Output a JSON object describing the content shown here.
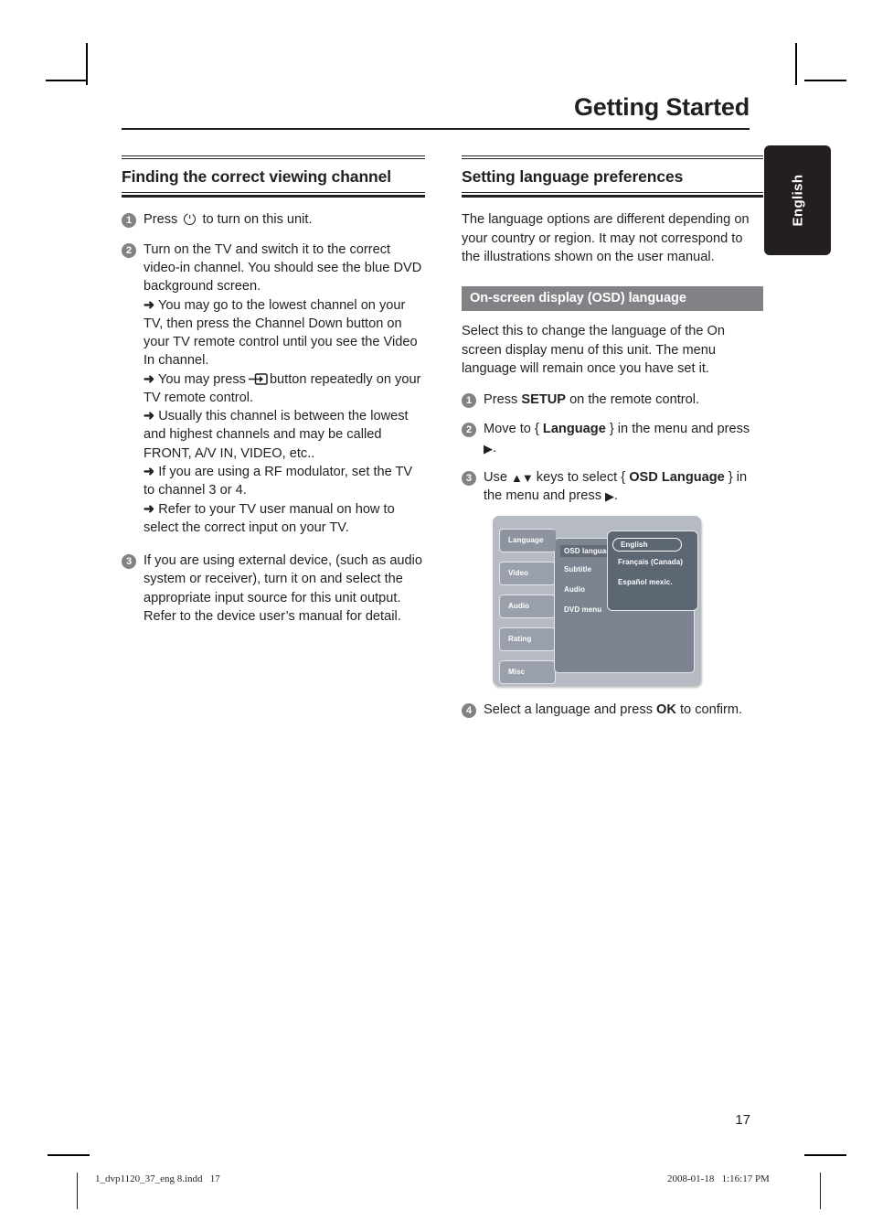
{
  "header": {
    "title": "Getting Started"
  },
  "side_tab": {
    "label": "English"
  },
  "left_column": {
    "heading": "Finding the correct viewing channel",
    "steps": [
      {
        "num": "1",
        "text_before": "Press",
        "icon": "power-icon",
        "text_after": "to turn on this unit."
      },
      {
        "num": "2",
        "text": "Turn on the TV and switch it to the correct video-in channel. You should see the blue DVD background screen.",
        "bullets": [
          "You may go to the lowest channel on your TV, then press the Channel Down button on your TV remote control until you see the Video In channel.",
          "You may press  button repeatedly on your TV remote control.",
          "Usually this channel is between the lowest and highest channels and may be called FRONT, A/V IN, VIDEO, etc..",
          "If you are using a RF modulator, set the TV to channel 3 or 4.",
          "Refer to your TV user manual on how to select the correct input on your TV."
        ],
        "bullet2_before": "You may press",
        "bullet2_icon": "tv-input-icon",
        "bullet2_after": "button repeatedly on your TV remote control."
      },
      {
        "num": "3",
        "text": "If you are using external device, (such as audio system or receiver), turn it on and select the appropriate input source for this unit output. Refer to the device user’s manual for detail."
      }
    ]
  },
  "right_column": {
    "heading": "Setting language preferences",
    "intro": "The language options are different depending on your country or region. It may not correspond to the illustrations shown on the user manual.",
    "banner": "On-screen display (OSD) language",
    "description": "Select this to change the language of the On screen display menu of this unit. The menu language will remain once you have set it.",
    "steps": [
      {
        "num": "1",
        "parts": [
          "Press ",
          "SETUP",
          " on the remote control."
        ]
      },
      {
        "num": "2",
        "parts": [
          "Move to { ",
          "Language",
          " } in the menu and press ",
          "▶",
          "."
        ]
      },
      {
        "num": "3",
        "parts": [
          "Use ",
          "▲▼",
          " keys to select { ",
          "OSD Language",
          " } in the menu and press ",
          "▶",
          "."
        ]
      },
      {
        "num": "4",
        "parts": [
          "Select a language and press ",
          "OK",
          " to confirm."
        ]
      }
    ]
  },
  "osd_menu": {
    "tabs": [
      {
        "label": "Language",
        "active": true
      },
      {
        "label": "Video",
        "active": false
      },
      {
        "label": "Audio",
        "active": false
      },
      {
        "label": "Rating",
        "active": false
      },
      {
        "label": "Misc",
        "active": false
      }
    ],
    "items": [
      {
        "label": "OSD language",
        "selected": true
      },
      {
        "label": "Subtitle",
        "selected": false
      },
      {
        "label": "Audio",
        "selected": false
      },
      {
        "label": "DVD menu",
        "selected": false
      }
    ],
    "languages": [
      {
        "label": "English",
        "selected": true
      },
      {
        "label": "Français (Canada)",
        "selected": false
      },
      {
        "label": "Español mexic.",
        "selected": false
      }
    ],
    "colors": {
      "frame": "#b6bac2",
      "tab": "#9aa0ab",
      "tab_active": "#8d949f",
      "mid_panel": "#7b8490",
      "sub_panel": "#5d6673",
      "item_selected": "#646c78"
    }
  },
  "footer": {
    "page_number": "17",
    "file_name": "1_dvp1120_37_eng 8.indd   17",
    "timestamp": "2008-01-18   1:16:17 PM"
  }
}
